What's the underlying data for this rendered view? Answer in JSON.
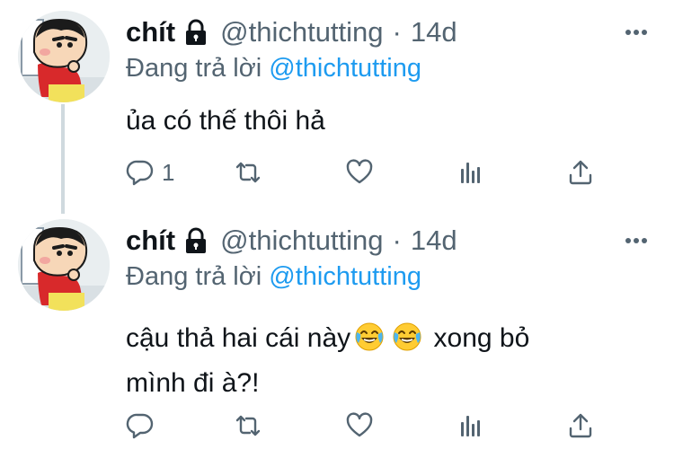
{
  "tweets": [
    {
      "author_name": "chít",
      "handle": "@thichtutting",
      "separator": "·",
      "time": "14d",
      "replying_prefix": "Đang trả lời",
      "replying_to": "@thichtutting",
      "text": "ủa có thế thôi hả",
      "reply_count": "1",
      "icons": [
        "lock-icon",
        "more-icon",
        "reply-icon",
        "retweet-icon",
        "like-icon",
        "analytics-icon",
        "share-icon"
      ]
    },
    {
      "author_name": "chít",
      "handle": "@thichtutting",
      "separator": "·",
      "time": "14d",
      "replying_prefix": "Đang trả lời",
      "replying_to": "@thichtutting",
      "text_part1": "cậu thả hai cái này",
      "text_part2": "xong bỏ",
      "text_line2": "mình đi à?!",
      "emoji": "face-with-tears-of-joy",
      "icons": [
        "lock-icon",
        "more-icon",
        "reply-icon",
        "retweet-icon",
        "like-icon",
        "analytics-icon",
        "share-icon"
      ]
    }
  ],
  "colors": {
    "text": "#0f1419",
    "secondary": "#536471",
    "link": "#1d9bf0",
    "thread_line": "#cfd9de"
  }
}
